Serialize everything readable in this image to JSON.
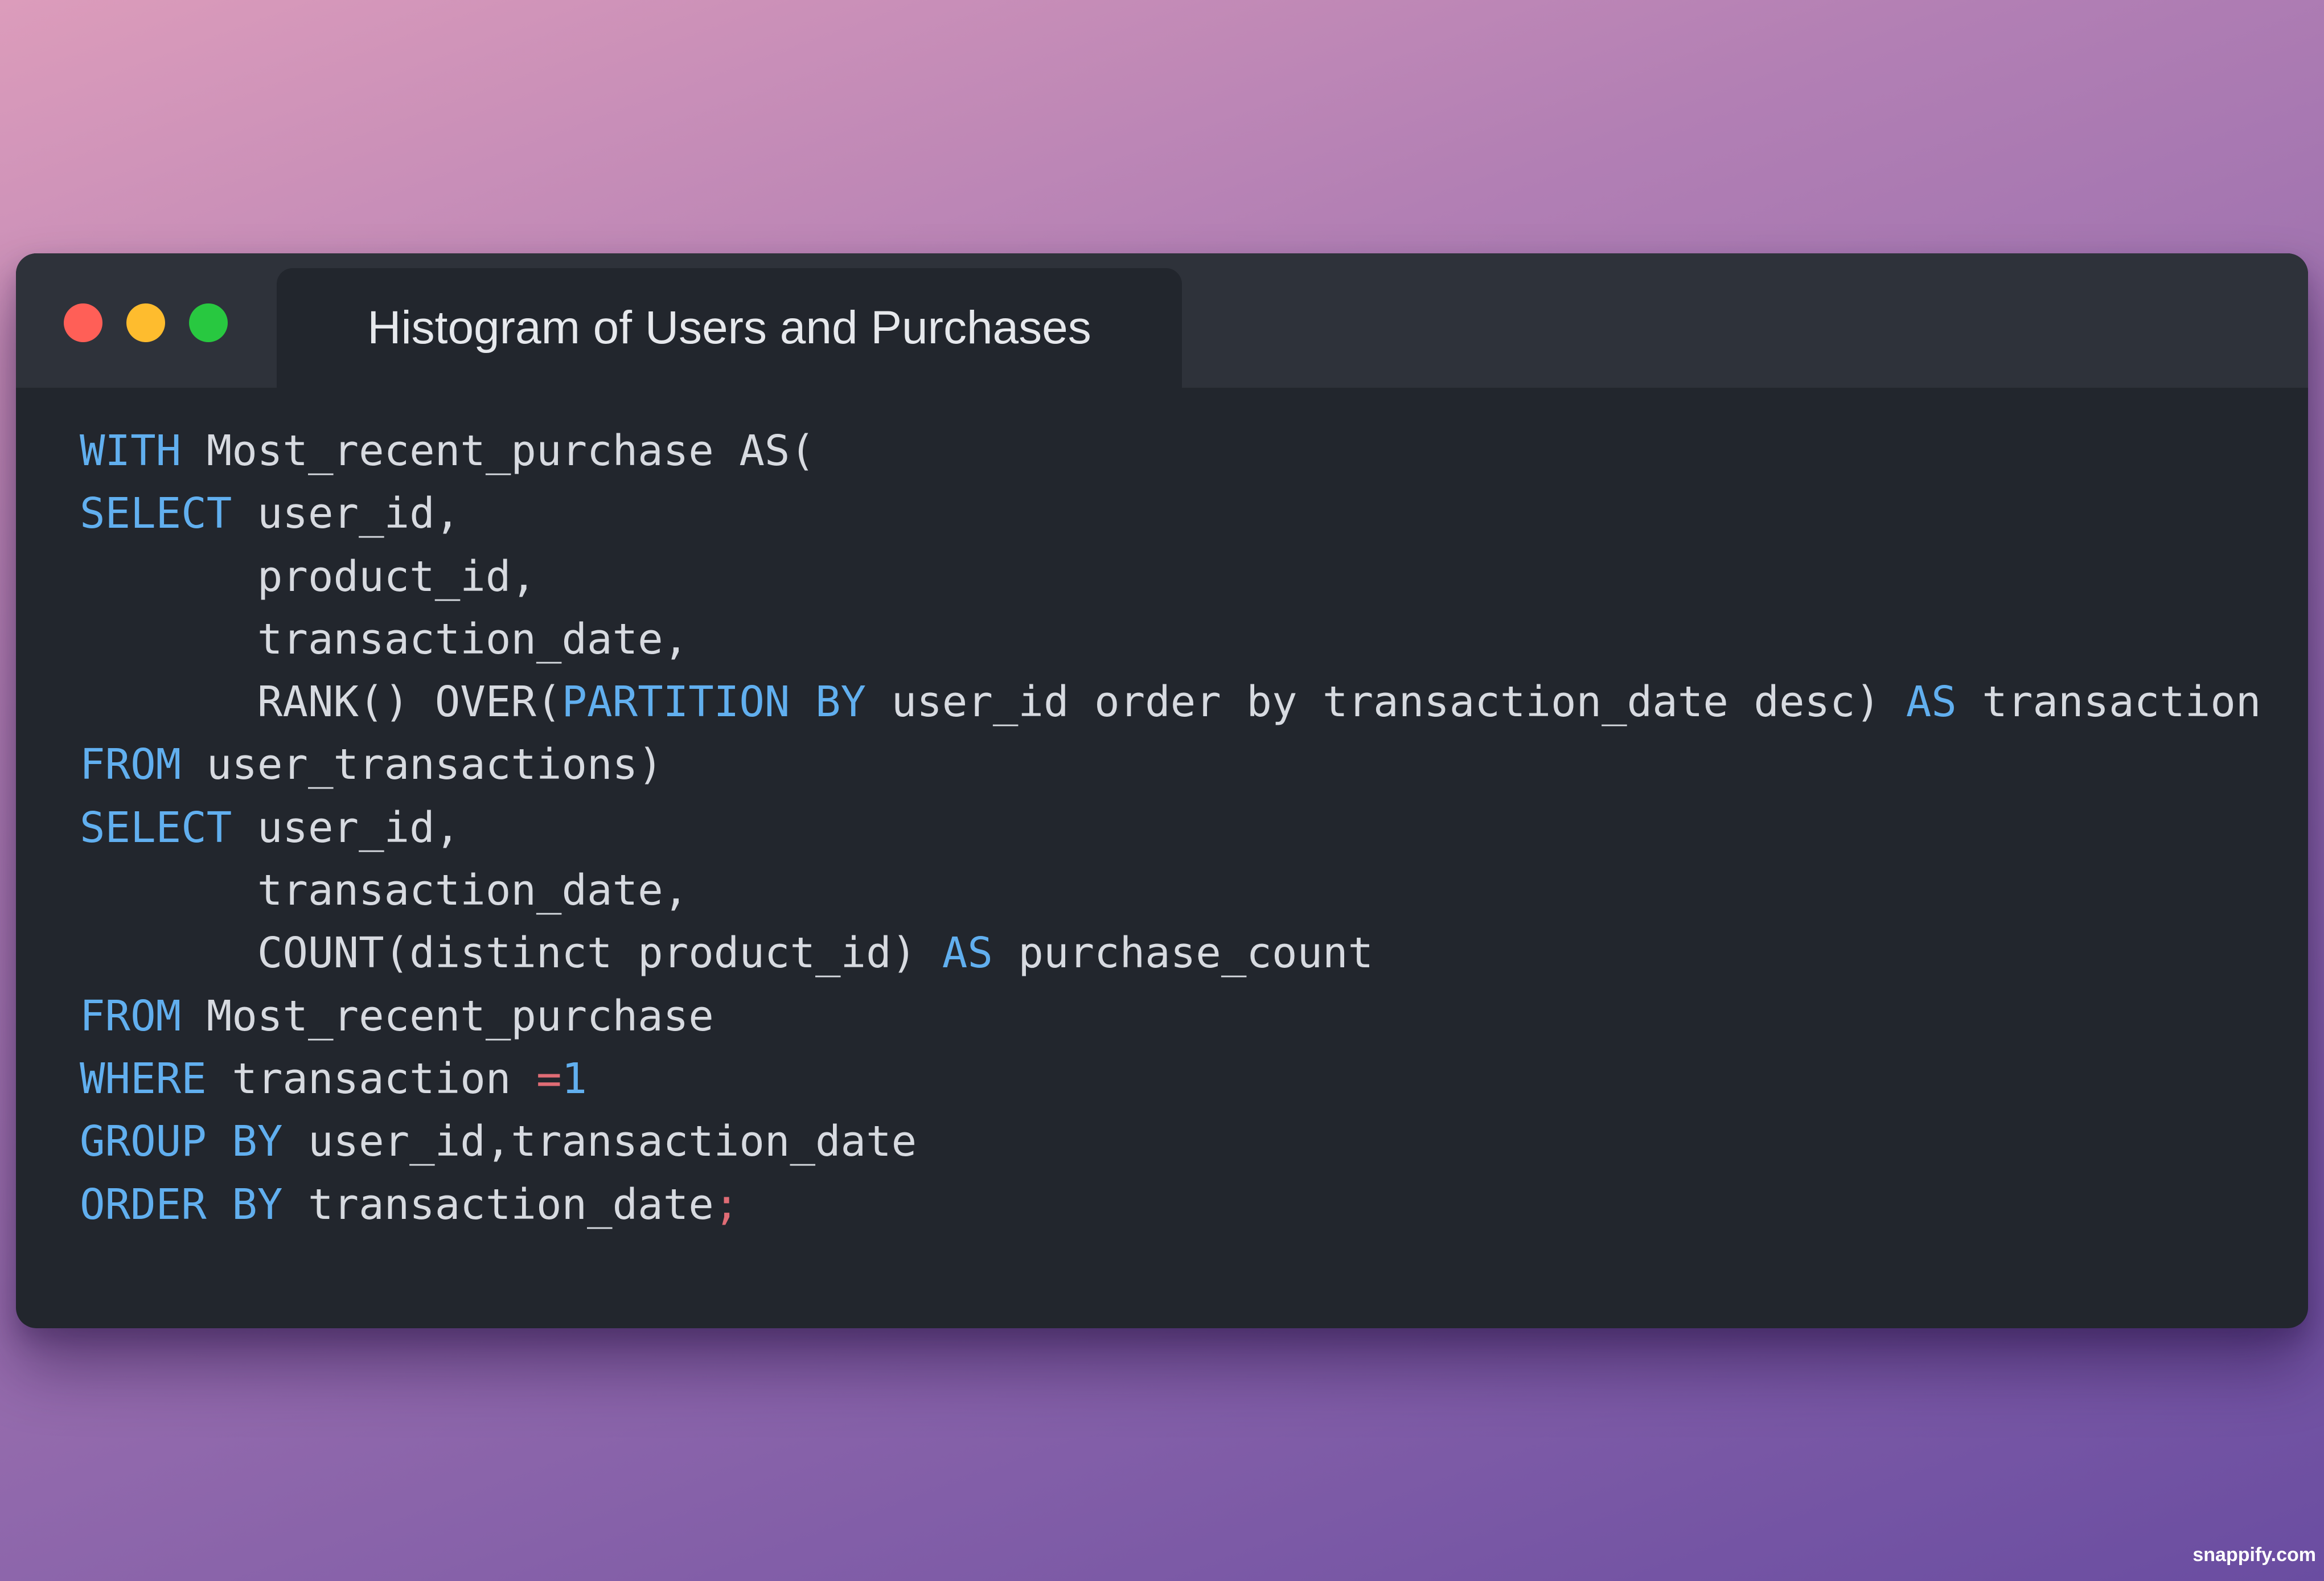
{
  "window": {
    "title": "Histogram of Users and Purchases",
    "controls": [
      {
        "name": "close",
        "color": "#ff5f57"
      },
      {
        "name": "minimize",
        "color": "#febc2e"
      },
      {
        "name": "maximize",
        "color": "#28c840"
      }
    ]
  },
  "colors": {
    "keyword": "#61afef",
    "plain": "#d7dae0",
    "operator": "#e06c75",
    "number": "#61afef",
    "punctuation": "#e06c75"
  },
  "code": {
    "language": "SQL",
    "lines": [
      [
        {
          "t": "WITH",
          "c": "keyword"
        },
        {
          "t": " Most_recent_purchase AS(",
          "c": "plain"
        }
      ],
      [
        {
          "t": "SELECT",
          "c": "keyword"
        },
        {
          "t": " user_id,",
          "c": "plain"
        }
      ],
      [
        {
          "t": "       product_id,",
          "c": "plain"
        }
      ],
      [
        {
          "t": "       transaction_date,",
          "c": "plain"
        }
      ],
      [
        {
          "t": "       RANK() OVER(",
          "c": "plain"
        },
        {
          "t": "PARTITION BY",
          "c": "keyword"
        },
        {
          "t": " user_id order by transaction_date desc) ",
          "c": "plain"
        },
        {
          "t": "AS",
          "c": "keyword"
        },
        {
          "t": " transaction",
          "c": "plain"
        }
      ],
      [
        {
          "t": "FROM",
          "c": "keyword"
        },
        {
          "t": " user_transactions)",
          "c": "plain"
        }
      ],
      [
        {
          "t": "SELECT",
          "c": "keyword"
        },
        {
          "t": " user_id,",
          "c": "plain"
        }
      ],
      [
        {
          "t": "       transaction_date,",
          "c": "plain"
        }
      ],
      [
        {
          "t": "       COUNT(distinct product_id) ",
          "c": "plain"
        },
        {
          "t": "AS",
          "c": "keyword"
        },
        {
          "t": " purchase_count",
          "c": "plain"
        }
      ],
      [
        {
          "t": "FROM",
          "c": "keyword"
        },
        {
          "t": " Most_recent_purchase",
          "c": "plain"
        }
      ],
      [
        {
          "t": "WHERE",
          "c": "keyword"
        },
        {
          "t": " transaction ",
          "c": "plain"
        },
        {
          "t": "=",
          "c": "operator"
        },
        {
          "t": "1",
          "c": "number"
        }
      ],
      [
        {
          "t": "GROUP BY",
          "c": "keyword"
        },
        {
          "t": " user_id,transaction_date",
          "c": "plain"
        }
      ],
      [
        {
          "t": "ORDER BY",
          "c": "keyword"
        },
        {
          "t": " transaction_date",
          "c": "plain"
        },
        {
          "t": ";",
          "c": "punctuation"
        }
      ]
    ]
  },
  "watermark": "snappify.com"
}
